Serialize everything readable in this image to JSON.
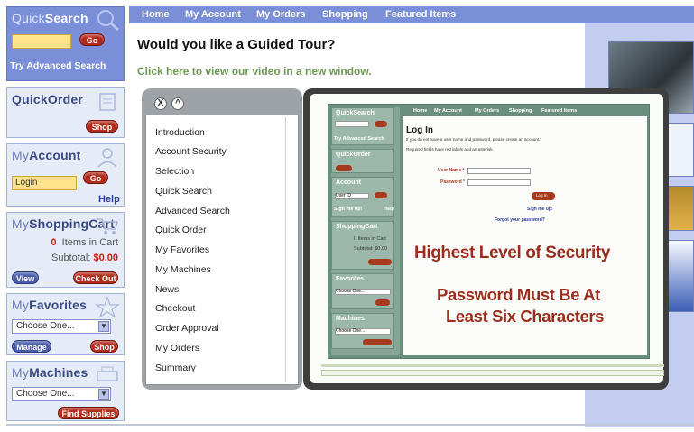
{
  "sidebar": {
    "quicksearch": {
      "title_a": "Quick",
      "title_b": "Search",
      "go": "Go",
      "advanced": "Try Advanced Search"
    },
    "quickorder": {
      "title_a": "Quick",
      "title_b": "Order",
      "shop": "Shop"
    },
    "myaccount": {
      "title_a": "My",
      "title_b": "Account",
      "login_value": "Login",
      "go": "Go",
      "help": "Help"
    },
    "cart": {
      "title_a": "My",
      "title_b": "ShoppingCart",
      "items_count": "0",
      "items_label": "Items in Cart",
      "subtotal_label": "Subtotal:",
      "subtotal": "$0.00",
      "view": "View",
      "checkout": "Check Out"
    },
    "favorites": {
      "title_a": "My",
      "title_b": "Favorites",
      "select": "Choose One...",
      "manage": "Manage",
      "shop": "Shop"
    },
    "machines": {
      "title_a": "My",
      "title_b": "Machines",
      "select": "Choose One...",
      "find": "Find Supplies"
    }
  },
  "topnav": {
    "items": [
      "Home",
      "My Account",
      "My Orders",
      "Shopping",
      "Featured Items"
    ]
  },
  "main": {
    "headline": "Would you like a Guided Tour?",
    "video_link": "Click here to view our video in a new window."
  },
  "tour": {
    "close": "X",
    "collapse": "^",
    "items": [
      "Introduction",
      "Account Security",
      "Selection",
      "Quick Search",
      "Advanced Search",
      "Quick Order",
      "My Favorites",
      "My Machines",
      "News",
      "Checkout",
      "Order Approval",
      "My Orders",
      "Summary"
    ]
  },
  "preview": {
    "nav": [
      "Home",
      "My Account",
      "My Orders",
      "Shopping",
      "Featured Items"
    ],
    "left": {
      "quicksearch": "QuickSearch",
      "advanced": "Try Advanced Search",
      "quickorder": "QuickOrder",
      "account": "Account",
      "user_id": "User ID",
      "sign_me_up": "Sign me up!",
      "help": "Help",
      "cart": "ShoppingCart",
      "items": "0 Items in Cart",
      "subtotal": "Subtotal: $0.00",
      "favorites": "Favorites",
      "machines": "Machines",
      "choose": "Choose One..."
    },
    "login_title": "Log In",
    "login_sub": "If you do not have a user name and password, please create an account.",
    "required": "Required fields have red labels and an asterisk.",
    "user_name": "User Name *",
    "password": "Password *",
    "login_btn": "Log In",
    "sign_me_up": "Sign me up!",
    "forgot": "Forgot your password?",
    "overlay_1": "Highest Level of Security",
    "overlay_2": "Password Must Be At",
    "overlay_3": "Least Six Characters"
  },
  "colors": {
    "nav_blue": "#7b8ed8",
    "accent_red": "#b32b1c",
    "overlay_red": "#9b2d1d",
    "link_green": "#6b9a52"
  }
}
